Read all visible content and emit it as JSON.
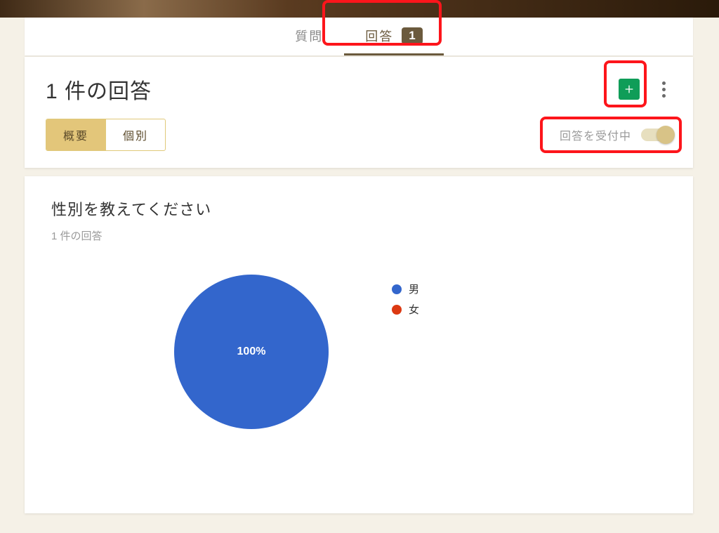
{
  "tabs": {
    "questions": "質問",
    "responses": "回答",
    "responses_count": "1"
  },
  "header": {
    "title": "1 件の回答"
  },
  "view_tabs": {
    "summary": "概要",
    "individual": "個別"
  },
  "accepting": {
    "label": "回答を受付中",
    "on": true
  },
  "question": {
    "title": "性別を教えてください",
    "subtitle": "1 件の回答"
  },
  "chart_data": {
    "type": "pie",
    "title": "性別を教えてください",
    "series": [
      {
        "name": "男",
        "value": 1,
        "percent": 100,
        "color": "#3366cc"
      },
      {
        "name": "女",
        "value": 0,
        "percent": 0,
        "color": "#dc3912"
      }
    ],
    "center_label": "100%"
  },
  "legend": {
    "male": "男",
    "female": "女"
  },
  "colors": {
    "accent": "#6b5a3d",
    "pill": "#e3c67a",
    "sheets": "#0f9d58",
    "pie_blue": "#3366cc",
    "pie_red": "#dc3912",
    "highlight": "#fd151b"
  }
}
